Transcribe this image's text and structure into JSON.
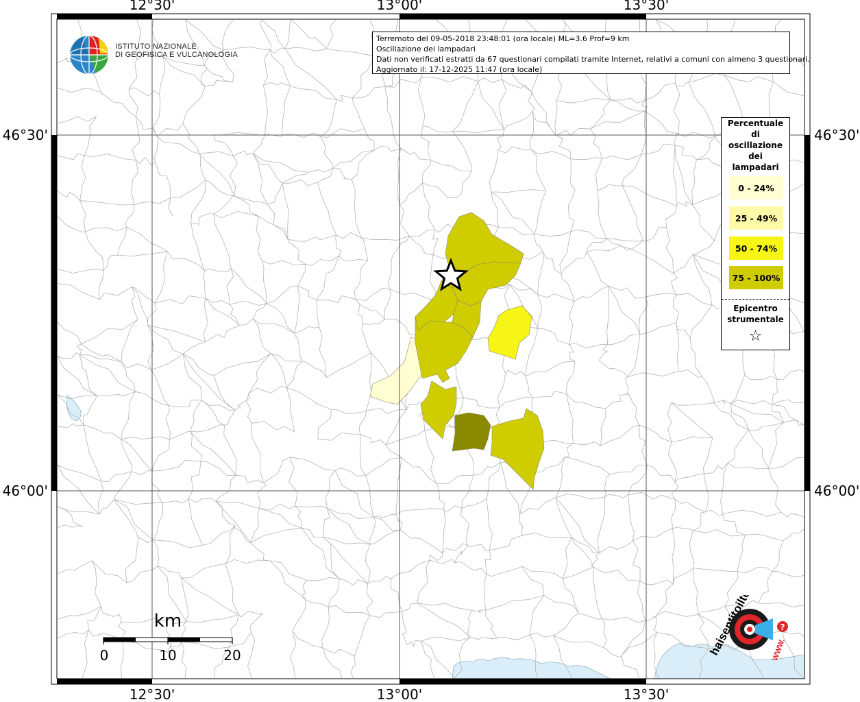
{
  "axes": {
    "lon_ticks": [
      "12°30'",
      "13°00'",
      "13°30'"
    ],
    "lat_ticks": [
      "46°30'",
      "46°00'"
    ]
  },
  "info": {
    "line1": "Terremoto del 09-05-2018 23:48:01 (ora locale) ML=3.6 Prof=9 km",
    "line2": "Oscillazione dei lampadari",
    "line3": "Dati non verificati estratti da 67 questionari compilati tramite Internet, relativi a comuni con almeno 3 questionari.",
    "line4": "Aggiornato il: 17-12-2025 11:47 (ora locale)"
  },
  "legend": {
    "title_lines": [
      "Percentuale",
      "di",
      "oscillazione",
      "dei",
      "lampadari"
    ],
    "classes": [
      {
        "label": "0 - 24%",
        "color": "#fffdd2"
      },
      {
        "label": "25 - 49%",
        "color": "#fffaa8"
      },
      {
        "label": "50 - 74%",
        "color": "#f6f516"
      },
      {
        "label": "75 - 100%",
        "color": "#cfcd00"
      }
    ],
    "epicenter_lines": [
      "Epicentro",
      "strumentale"
    ],
    "epicenter_symbol": "☆",
    "dark_class_color": "#8a8a00"
  },
  "logo_ingv": {
    "line1": "ISTITUTO NAZIONALE",
    "line2": "DI GEOFISICA E VULCANOLOGIA"
  },
  "logo_hst": {
    "text": "haisentitoilterremoto.it",
    "www": "WWW.",
    "badge": "?"
  },
  "scalebar": {
    "unit": "km",
    "labels": [
      "0",
      "10",
      "20"
    ]
  },
  "colors": {
    "water": "#daeefa",
    "boundary": "#b0b0b0",
    "grid": "#555555"
  }
}
